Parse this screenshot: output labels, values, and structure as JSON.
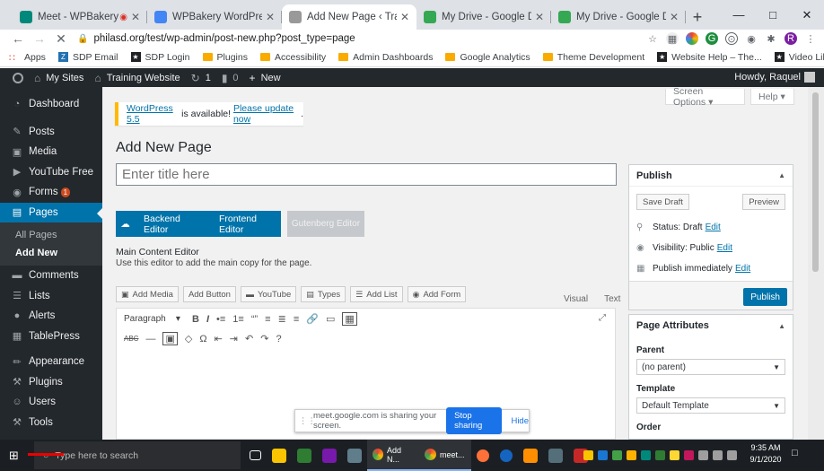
{
  "browser": {
    "tabs": [
      {
        "title": "Meet - WPBakery WordP",
        "fav_color": "#00897b",
        "has_record": true,
        "active": false
      },
      {
        "title": "WPBakery WordPress Training",
        "fav_color": "#4285f4",
        "has_record": false,
        "active": false
      },
      {
        "title": "Add New Page ‹ Training Websi",
        "fav_color": "#999999",
        "has_record": false,
        "active": true
      },
      {
        "title": "My Drive - Google Drive",
        "fav_color": "#34a853",
        "has_record": false,
        "active": false
      },
      {
        "title": "My Drive - Google Drive",
        "fav_color": "#34a853",
        "has_record": false,
        "active": false
      }
    ],
    "url": "philasd.org/test/wp-admin/post-new.php?post_type=page",
    "profile_initial": "R",
    "bookmarks": [
      {
        "label": "Apps",
        "kind": "apps"
      },
      {
        "label": "SDP Email",
        "kind": "sq"
      },
      {
        "label": "SDP Login",
        "kind": "blk"
      },
      {
        "label": "Plugins",
        "kind": "folder"
      },
      {
        "label": "Accessibility",
        "kind": "folder"
      },
      {
        "label": "Admin Dashboards",
        "kind": "folder"
      },
      {
        "label": "Google Analytics",
        "kind": "folder"
      },
      {
        "label": "Theme Development",
        "kind": "folder"
      },
      {
        "label": "Website Help – The...",
        "kind": "blk"
      },
      {
        "label": "Video Library – We...",
        "kind": "blk"
      }
    ]
  },
  "adminbar": {
    "my_sites": "My Sites",
    "site": "Training Website",
    "updates": "1",
    "comments": "0",
    "new": "New",
    "howdy": "Howdy, Raquel"
  },
  "sidebar": {
    "items": [
      {
        "label": "Dashboard",
        "icon": "◔",
        "name": "dashboard"
      },
      {
        "label": "Posts",
        "icon": "✎",
        "name": "posts"
      },
      {
        "label": "Media",
        "icon": "▣",
        "name": "media"
      },
      {
        "label": "YouTube Free",
        "icon": "▶",
        "name": "youtube-free"
      },
      {
        "label": "Forms",
        "icon": "◉",
        "name": "forms",
        "badge": "1"
      }
    ],
    "current": {
      "label": "Pages",
      "icon": "▤"
    },
    "submenu": [
      "All Pages",
      "Add New"
    ],
    "items_after": [
      {
        "label": "Comments",
        "icon": "▬",
        "name": "comments"
      },
      {
        "label": "Lists",
        "icon": "☰",
        "name": "lists"
      },
      {
        "label": "Alerts",
        "icon": "●",
        "name": "alerts"
      },
      {
        "label": "TablePress",
        "icon": "▦",
        "name": "tablepress"
      },
      {
        "label": "Appearance",
        "icon": "✏",
        "name": "appearance"
      },
      {
        "label": "Plugins",
        "icon": "⚒",
        "name": "plugins"
      },
      {
        "label": "Users",
        "icon": "☺",
        "name": "users"
      },
      {
        "label": "Tools",
        "icon": "⚒",
        "name": "tools"
      }
    ]
  },
  "screen": {
    "screen_options": "Screen Options ▾",
    "help": "Help ▾",
    "notice_link1": "WordPress 5.5",
    "notice_text": " is available! ",
    "notice_link2": "Please update now",
    "page_title": "Add New Page",
    "title_placeholder": "Enter title here",
    "backend_editor": "Backend Editor",
    "frontend_editor": "Frontend Editor",
    "gutenberg": "Gutenberg Editor",
    "main_label": "Main Content Editor",
    "main_desc": "Use this editor to add the main copy for the page.",
    "media_buttons": [
      {
        "label": "Add Media",
        "icon": "▣"
      },
      {
        "label": "Add Button",
        "icon": ""
      },
      {
        "label": "YouTube",
        "icon": "▬"
      },
      {
        "label": "Types",
        "icon": "▤"
      },
      {
        "label": "Add List",
        "icon": "☰"
      },
      {
        "label": "Add Form",
        "icon": "◉"
      }
    ],
    "visual_tab": "Visual",
    "text_tab": "Text",
    "format": "Paragraph",
    "toolbar1": [
      "B",
      "I",
      "•≡",
      "1≡",
      "“”",
      "≡",
      "≣",
      "≡",
      "🔗",
      "▭",
      "▦"
    ],
    "toolbar2": [
      "ABC",
      "—",
      "▣",
      "◇",
      "Ω",
      "⇤",
      "⇥",
      "↶",
      "↷",
      "?"
    ]
  },
  "publish": {
    "title": "Publish",
    "save_draft": "Save Draft",
    "preview": "Preview",
    "status_label": "Status: Draft",
    "visibility_label": "Visibility: Public",
    "schedule_label": "Publish immediately",
    "edit": "Edit",
    "publish_btn": "Publish"
  },
  "attributes": {
    "title": "Page Attributes",
    "parent_label": "Parent",
    "parent_value": "(no parent)",
    "template_label": "Template",
    "template_value": "Default Template",
    "order_label": "Order"
  },
  "meet": {
    "text": "meet.google.com is sharing your screen.",
    "stop": "Stop sharing",
    "hide": "Hide"
  },
  "taskbar": {
    "search": "Type here to search",
    "app1": "Add N...",
    "app2": "meet...",
    "time": "9:35 AM",
    "date": "9/1/2020"
  }
}
